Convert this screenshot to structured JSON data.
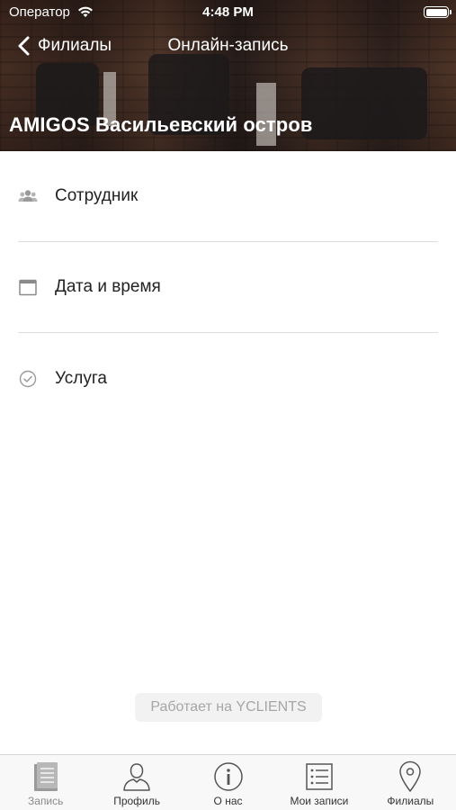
{
  "status_bar": {
    "carrier": "Оператор",
    "time": "4:48 PM"
  },
  "nav": {
    "back_label": "Филиалы",
    "title": "Онлайн-запись"
  },
  "branch": {
    "name": "AMIGOS Васильевский остров"
  },
  "menu": {
    "items": [
      {
        "label": "Сотрудник",
        "icon": "people-icon"
      },
      {
        "label": "Дата и время",
        "icon": "calendar-icon"
      },
      {
        "label": "Услуга",
        "icon": "check-circle-icon"
      }
    ]
  },
  "powered_by": "Работает на YCLIENTS",
  "tabbar": {
    "items": [
      {
        "label": "Запись",
        "icon": "document-icon",
        "active": true
      },
      {
        "label": "Профиль",
        "icon": "person-icon",
        "active": false
      },
      {
        "label": "О нас",
        "icon": "info-icon",
        "active": false
      },
      {
        "label": "Мои записи",
        "icon": "list-icon",
        "active": false
      },
      {
        "label": "Филиалы",
        "icon": "location-pin-icon",
        "active": false
      }
    ]
  },
  "colors": {
    "text": "#222222",
    "separator": "#dddddd",
    "muted": "#a6a6a6",
    "tabbar_bg": "#f8f8f8"
  }
}
